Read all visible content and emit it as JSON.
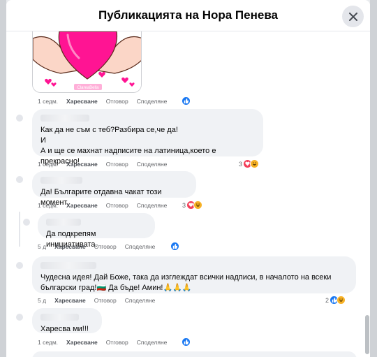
{
  "header": {
    "title": "Публикацията на Нора Пенева"
  },
  "image": {
    "watermark": "ClareaBella"
  },
  "actions": {
    "like": "Харесване",
    "reply": "Отговор",
    "share": "Споделяне"
  },
  "comments": [
    {
      "time": "1 седм.",
      "reaction_count": ""
    },
    {
      "time": "1 седм.",
      "lines": [
        "Как да не съм с теб?Разбира се,че да!",
        "И",
        "А и ще се махнат надписите на латиница,което е прекрасно!"
      ],
      "reaction_count": "3"
    },
    {
      "time": "1 седм.",
      "lines": [
        "Да! Българите отдавна чакат този момент."
      ],
      "reaction_count": "3"
    },
    {
      "time": "5 д",
      "lines": [
        "Да подкрепям инициативата."
      ],
      "reaction_count": ""
    },
    {
      "time": "5 д",
      "lines": [
        "Чудесна идея! Дай Боже, така да изглеждат всички надписи, в началото на всеки",
        "български град!🇧🇬 Да бъде! Амин!🙏🙏🙏"
      ],
      "reaction_count": "2"
    },
    {
      "time": "1 седм.",
      "lines": [
        "Харесва ми!!!"
      ],
      "reaction_count": ""
    }
  ],
  "colors": {
    "like": "#1877f2",
    "love": "#f33e58",
    "haha": "#f7b125",
    "heart": "#ff1493"
  }
}
